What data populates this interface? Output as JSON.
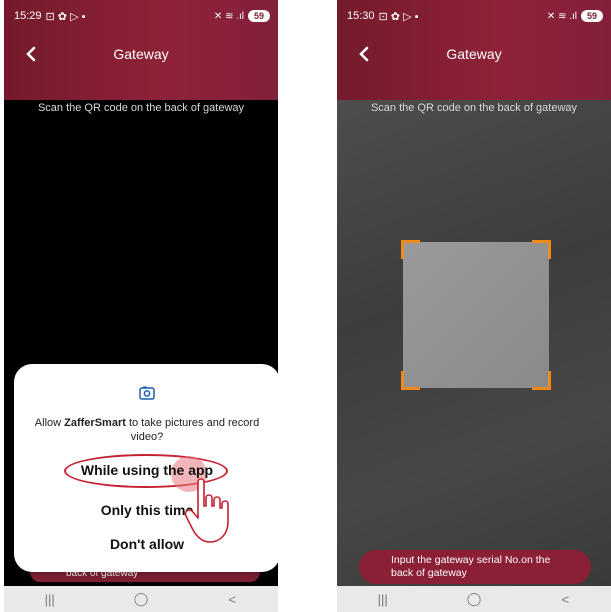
{
  "left_screen": {
    "status_time": "15:29",
    "status_icons": "⊡ ✿ ▷ •",
    "status_right": "✕ ≋ .ıl",
    "battery": "59",
    "title": "Gateway",
    "scan_hint": "Scan the QR code on the back of gateway",
    "bg_serial_text": "back of gateway",
    "dialog": {
      "message_prefix": "Allow ",
      "app_name": "ZafferSmart",
      "message_suffix": " to take pictures and record video?",
      "options": [
        "While using the app",
        "Only this time",
        "Don't allow"
      ]
    },
    "nav": [
      "|||",
      "◯",
      "<"
    ]
  },
  "right_screen": {
    "status_time": "15:30",
    "status_icons": "⊡ ✿ ▷ •",
    "status_right": "✕ ≋ .ıl",
    "battery": "59",
    "title": "Gateway",
    "scan_hint": "Scan the QR code on the back of gateway",
    "serial_button_line1": "Input the gateway serial No.on the",
    "serial_button_line2": "back of gateway",
    "nav": [
      "|||",
      "◯",
      "<"
    ]
  },
  "colors": {
    "brand": "#8a1f35",
    "scan_corner": "#f08a1a",
    "highlight": "#c52232"
  }
}
